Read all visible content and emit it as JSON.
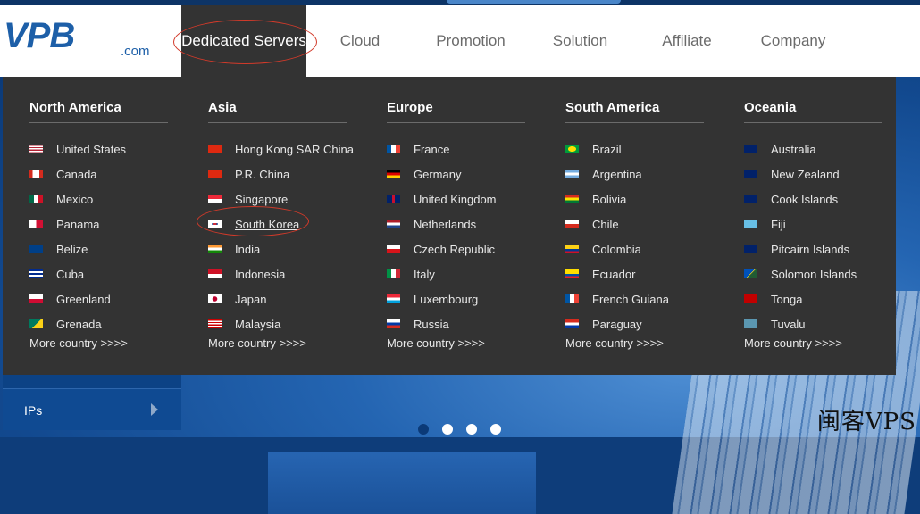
{
  "header": {
    "logo_text": "VPB",
    "logo_suffix": ".com",
    "nav": [
      {
        "label": "Dedicated Servers"
      },
      {
        "label": "Cloud"
      },
      {
        "label": "Promotion"
      },
      {
        "label": "Solution"
      },
      {
        "label": "Affiliate"
      },
      {
        "label": "Company"
      }
    ]
  },
  "menu": {
    "columns": [
      {
        "title": "North America",
        "items": [
          {
            "label": "United States",
            "flag": "us"
          },
          {
            "label": "Canada",
            "flag": "ca"
          },
          {
            "label": "Mexico",
            "flag": "mx"
          },
          {
            "label": "Panama",
            "flag": "pa"
          },
          {
            "label": "Belize",
            "flag": "bz"
          },
          {
            "label": "Cuba",
            "flag": "cu"
          },
          {
            "label": "Greenland",
            "flag": "gl"
          },
          {
            "label": "Grenada",
            "flag": "gd"
          }
        ],
        "more": "More country >>>>"
      },
      {
        "title": "Asia",
        "items": [
          {
            "label": "Hong Kong SAR China",
            "flag": "hk"
          },
          {
            "label": "P.R. China",
            "flag": "cn"
          },
          {
            "label": "Singapore",
            "flag": "sg"
          },
          {
            "label": "South Korea",
            "flag": "kr"
          },
          {
            "label": "India",
            "flag": "in"
          },
          {
            "label": "Indonesia",
            "flag": "id"
          },
          {
            "label": "Japan",
            "flag": "jp"
          },
          {
            "label": "Malaysia",
            "flag": "my"
          }
        ],
        "more": "More country >>>>"
      },
      {
        "title": "Europe",
        "items": [
          {
            "label": "France",
            "flag": "fr"
          },
          {
            "label": "Germany",
            "flag": "de"
          },
          {
            "label": "United Kingdom",
            "flag": "gb"
          },
          {
            "label": "Netherlands",
            "flag": "nl"
          },
          {
            "label": "Czech Republic",
            "flag": "cz"
          },
          {
            "label": "Italy",
            "flag": "it"
          },
          {
            "label": "Luxembourg",
            "flag": "lu"
          },
          {
            "label": "Russia",
            "flag": "ru"
          }
        ],
        "more": "More country >>>>"
      },
      {
        "title": "South America",
        "items": [
          {
            "label": "Brazil",
            "flag": "br"
          },
          {
            "label": "Argentina",
            "flag": "ar"
          },
          {
            "label": "Bolivia",
            "flag": "bo"
          },
          {
            "label": "Chile",
            "flag": "cl"
          },
          {
            "label": "Colombia",
            "flag": "co"
          },
          {
            "label": "Ecuador",
            "flag": "ec"
          },
          {
            "label": "French Guiana",
            "flag": "gf"
          },
          {
            "label": "Paraguay",
            "flag": "py"
          }
        ],
        "more": "More country >>>>"
      },
      {
        "title": "Oceania",
        "items": [
          {
            "label": "Australia",
            "flag": "au"
          },
          {
            "label": "New Zealand",
            "flag": "nz"
          },
          {
            "label": "Cook Islands",
            "flag": "ck"
          },
          {
            "label": "Fiji",
            "flag": "fj"
          },
          {
            "label": "Pitcairn Islands",
            "flag": "pn"
          },
          {
            "label": "Solomon Islands",
            "flag": "sb"
          },
          {
            "label": "Tonga",
            "flag": "to"
          },
          {
            "label": "Tuvalu",
            "flag": "tv"
          }
        ],
        "more": "More country >>>>"
      }
    ]
  },
  "sidebar": {
    "ips_label": "IPs"
  },
  "watermark": "闽客VPS",
  "colors": {
    "brand": "#1d5fa8",
    "menu_bg": "#333333",
    "annotation": "#d23a2a"
  }
}
